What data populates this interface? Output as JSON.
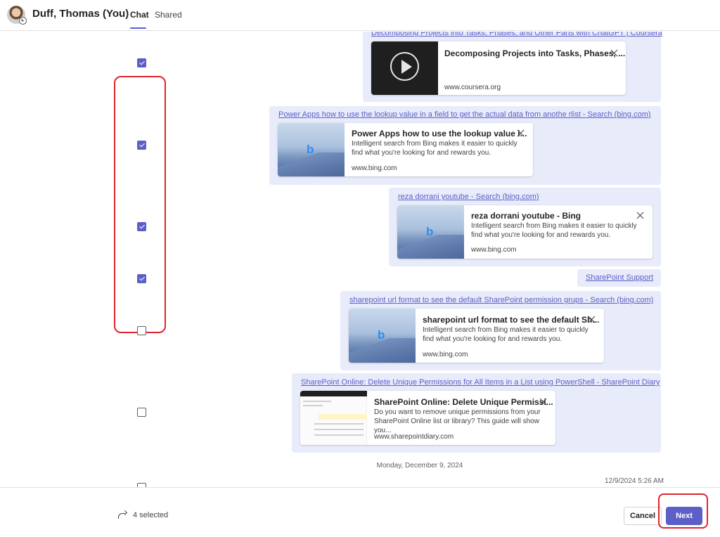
{
  "header": {
    "user_name": "Duff, Thomas (You)",
    "tabs": [
      {
        "label": "Chat",
        "active": true
      },
      {
        "label": "Shared",
        "active": false
      }
    ]
  },
  "colors": {
    "accent": "#5b5fc7",
    "bubble_bg": "#e8ebfa",
    "highlight_outline": "#e0242e"
  },
  "messages": [
    {
      "checked": true,
      "link_text": "Decomposing Projects into Tasks, Phases, and Other Parts with ChatGPT | Coursera",
      "card": {
        "thumbnail": "video-play-icon",
        "title": "Decomposing Projects into Tasks, Phases, ...",
        "description": "",
        "domain": "www.coursera.org"
      }
    },
    {
      "checked": true,
      "link_text": "Power Apps how to use the lookup value in a field to get the actual data from anothe rlist - Search (bing.com)",
      "card": {
        "thumbnail": "bing-logo",
        "title": "Power Apps how to use the lookup value i...",
        "description": "Intelligent search from Bing makes it easier to quickly find what you're looking for and rewards you.",
        "domain": "www.bing.com"
      }
    },
    {
      "checked": true,
      "link_text": "reza dorrani youtube - Search (bing.com)",
      "card": {
        "thumbnail": "bing-logo",
        "title": "reza dorrani youtube - Bing",
        "description": "Intelligent search from Bing makes it easier to quickly find what you're looking for and rewards you.",
        "domain": "www.bing.com"
      }
    },
    {
      "checked": true,
      "link_text": "SharePoint Support"
    },
    {
      "checked": false,
      "link_text": "sharepoint url format to see the default SharePoint permission grups - Search (bing.com)",
      "card": {
        "thumbnail": "bing-logo",
        "title": "sharepoint url format to see the default Sh...",
        "description": "Intelligent search from Bing makes it easier to quickly find what you're looking for and rewards you.",
        "domain": "www.bing.com"
      }
    },
    {
      "checked": false,
      "link_text": "SharePoint Online: Delete Unique Permissions for All Items in a List using PowerShell - SharePoint Diary",
      "card": {
        "thumbnail": "sharepoint-screenshot",
        "title": "SharePoint Online: Delete Unique Permissi...",
        "description": "Do you want to remove unique permissions from your SharePoint Online list or library? This guide will show you...",
        "domain": "www.sharepointdiary.com"
      }
    }
  ],
  "date_separator": "Monday, December 9, 2024",
  "timestamp": "12/9/2024 5:26 AM",
  "footer": {
    "selected_text": "4 selected",
    "cancel_label": "Cancel",
    "next_label": "Next"
  }
}
